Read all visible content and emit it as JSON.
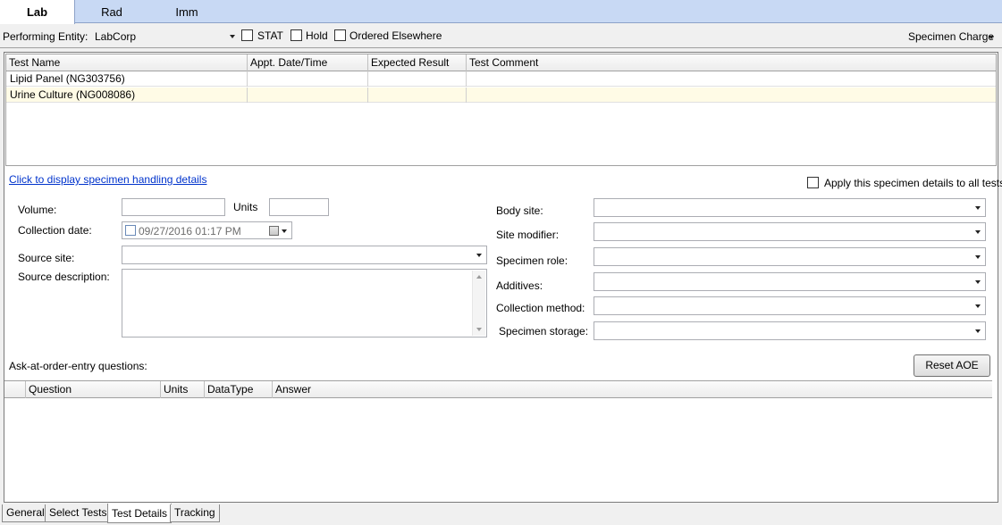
{
  "top_tabs": [
    "Lab",
    "Rad",
    "Imm"
  ],
  "toolbar": {
    "performing_entity_label": "Performing Entity:",
    "performing_entity_value": "LabCorp",
    "stat_label": "STAT",
    "hold_label": "Hold",
    "ordered_elsewhere_label": "Ordered Elsewhere",
    "specimen_charge_label": "Specimen Charge"
  },
  "tests_grid": {
    "columns": [
      "Test Name",
      "Appt. Date/Time",
      "Expected Result",
      "Test Comment"
    ],
    "rows": [
      {
        "name": "Lipid Panel (NG303756)",
        "appt": "",
        "expected": "",
        "comment": ""
      },
      {
        "name": "Urine Culture (NG008086)",
        "appt": "",
        "expected": "",
        "comment": ""
      }
    ]
  },
  "specimen": {
    "link_text": "Click to display specimen handling details",
    "apply_all_label": "Apply this specimen details to all tests",
    "volume_label": "Volume:",
    "units_label": "Units",
    "collection_date_label": "Collection date:",
    "collection_date_value": "09/27/2016 01:17 PM",
    "source_site_label": "Source site:",
    "source_description_label": "Source description:",
    "body_site_label": "Body site:",
    "site_modifier_label": "Site modifier:",
    "specimen_role_label": "Specimen role:",
    "additives_label": "Additives:",
    "collection_method_label": "Collection method:",
    "specimen_storage_label": "Specimen storage:"
  },
  "aoe": {
    "label": "Ask-at-order-entry questions:",
    "reset_button": "Reset AOE",
    "columns": [
      "Question",
      "Units",
      "DataType",
      "Answer"
    ]
  },
  "bottom_tabs": [
    "General",
    "Select Tests",
    "Test Details",
    "Tracking"
  ]
}
